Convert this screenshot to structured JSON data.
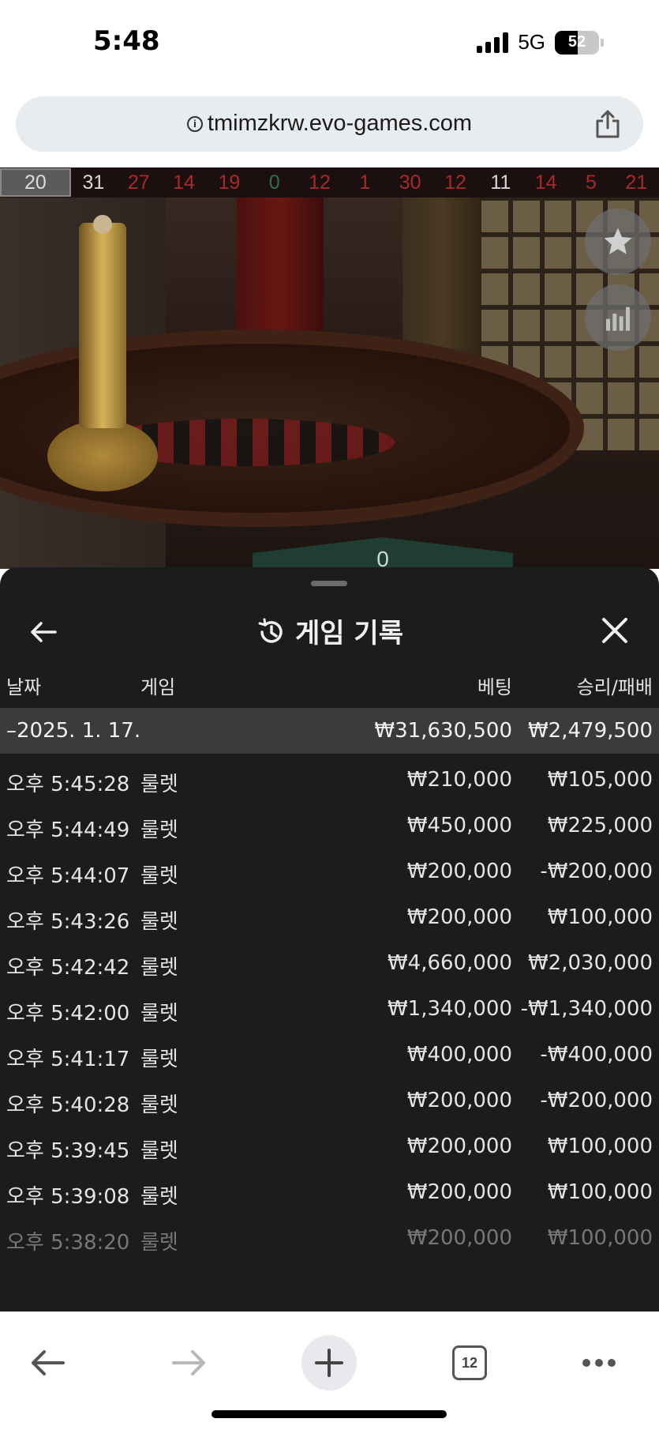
{
  "status_bar": {
    "time": "5:48",
    "network": "5G",
    "battery": "52"
  },
  "browser": {
    "url": "tmimzkrw.evo-games.com",
    "tab_count": "12"
  },
  "game": {
    "recent_numbers": [
      {
        "value": "20",
        "color": "gray"
      },
      {
        "value": "31",
        "color": "black"
      },
      {
        "value": "27",
        "color": "red"
      },
      {
        "value": "14",
        "color": "red"
      },
      {
        "value": "19",
        "color": "red"
      },
      {
        "value": "0",
        "color": "green"
      },
      {
        "value": "12",
        "color": "red"
      },
      {
        "value": "1",
        "color": "red"
      },
      {
        "value": "30",
        "color": "red"
      },
      {
        "value": "12",
        "color": "red"
      },
      {
        "value": "11",
        "color": "black"
      },
      {
        "value": "14",
        "color": "red"
      },
      {
        "value": "5",
        "color": "red"
      },
      {
        "value": "21",
        "color": "red"
      }
    ],
    "zero_label": "0"
  },
  "history": {
    "title": "게임 기록",
    "columns": {
      "date": "날짜",
      "game": "게임",
      "bet": "베팅",
      "result": "승리/패배"
    },
    "date_group": {
      "date": "–2025. 1. 17.",
      "bet_total": "₩31,630,500",
      "result_total": "₩2,479,500"
    },
    "rows": [
      {
        "time": "오후 5:45:28",
        "game": "룰렛",
        "bet": "₩210,000",
        "result": "₩105,000"
      },
      {
        "time": "오후 5:44:49",
        "game": "룰렛",
        "bet": "₩450,000",
        "result": "₩225,000"
      },
      {
        "time": "오후 5:44:07",
        "game": "룰렛",
        "bet": "₩200,000",
        "result": "-₩200,000"
      },
      {
        "time": "오후 5:43:26",
        "game": "룰렛",
        "bet": "₩200,000",
        "result": "₩100,000"
      },
      {
        "time": "오후 5:42:42",
        "game": "룰렛",
        "bet": "₩4,660,000",
        "result": "₩2,030,000"
      },
      {
        "time": "오후 5:42:00",
        "game": "룰렛",
        "bet": "₩1,340,000",
        "result": "-₩1,340,000"
      },
      {
        "time": "오후 5:41:17",
        "game": "룰렛",
        "bet": "₩400,000",
        "result": "-₩400,000"
      },
      {
        "time": "오후 5:40:28",
        "game": "룰렛",
        "bet": "₩200,000",
        "result": "-₩200,000"
      },
      {
        "time": "오후 5:39:45",
        "game": "룰렛",
        "bet": "₩200,000",
        "result": "₩100,000"
      },
      {
        "time": "오후 5:39:08",
        "game": "룰렛",
        "bet": "₩200,000",
        "result": "₩100,000"
      },
      {
        "time": "오후 5:38:20",
        "game": "룰렛",
        "bet": "₩200,000",
        "result": "₩100,000"
      }
    ]
  },
  "colors": {
    "sheet_bg": "#1c1c1c",
    "date_row_bg": "#3b3b3b",
    "red_number": "#a52a2a",
    "green_number": "#2c6e55"
  }
}
